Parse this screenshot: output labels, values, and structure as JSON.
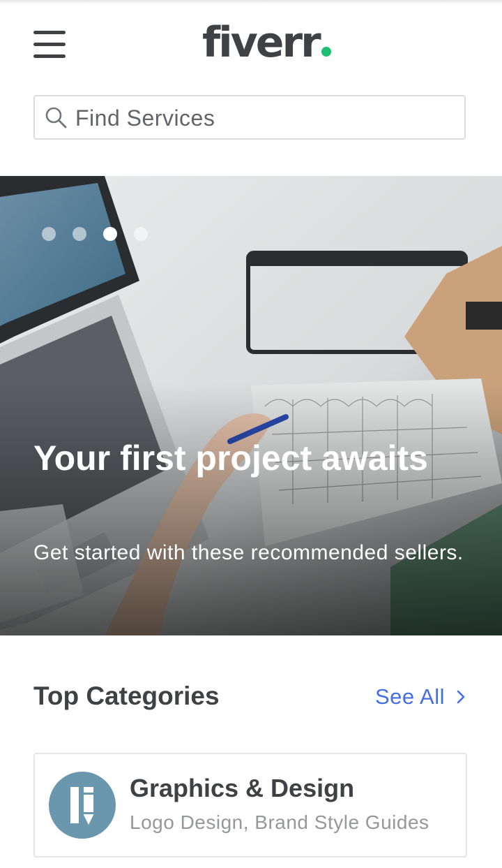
{
  "header": {
    "logo_text": "fiverr",
    "logo_dot_color": "#1dbf73",
    "menu_icon": "hamburger-menu-icon"
  },
  "search": {
    "placeholder": "Find Services",
    "icon": "search-icon"
  },
  "hero": {
    "slides_total": 4,
    "active_slide": 3,
    "title": "Your first project awaits",
    "subtitle": "Get started with these recommended sellers."
  },
  "categories": {
    "title": "Top Categories",
    "see_all_label": "See All",
    "items": [
      {
        "title": "Graphics & Design",
        "subtitle": "Logo Design, Brand Style Guides",
        "icon": "graphics-design-icon",
        "icon_bg": "#6a97ad"
      }
    ]
  },
  "colors": {
    "text": "#404145",
    "link": "#446ee7",
    "muted": "#95979d"
  }
}
